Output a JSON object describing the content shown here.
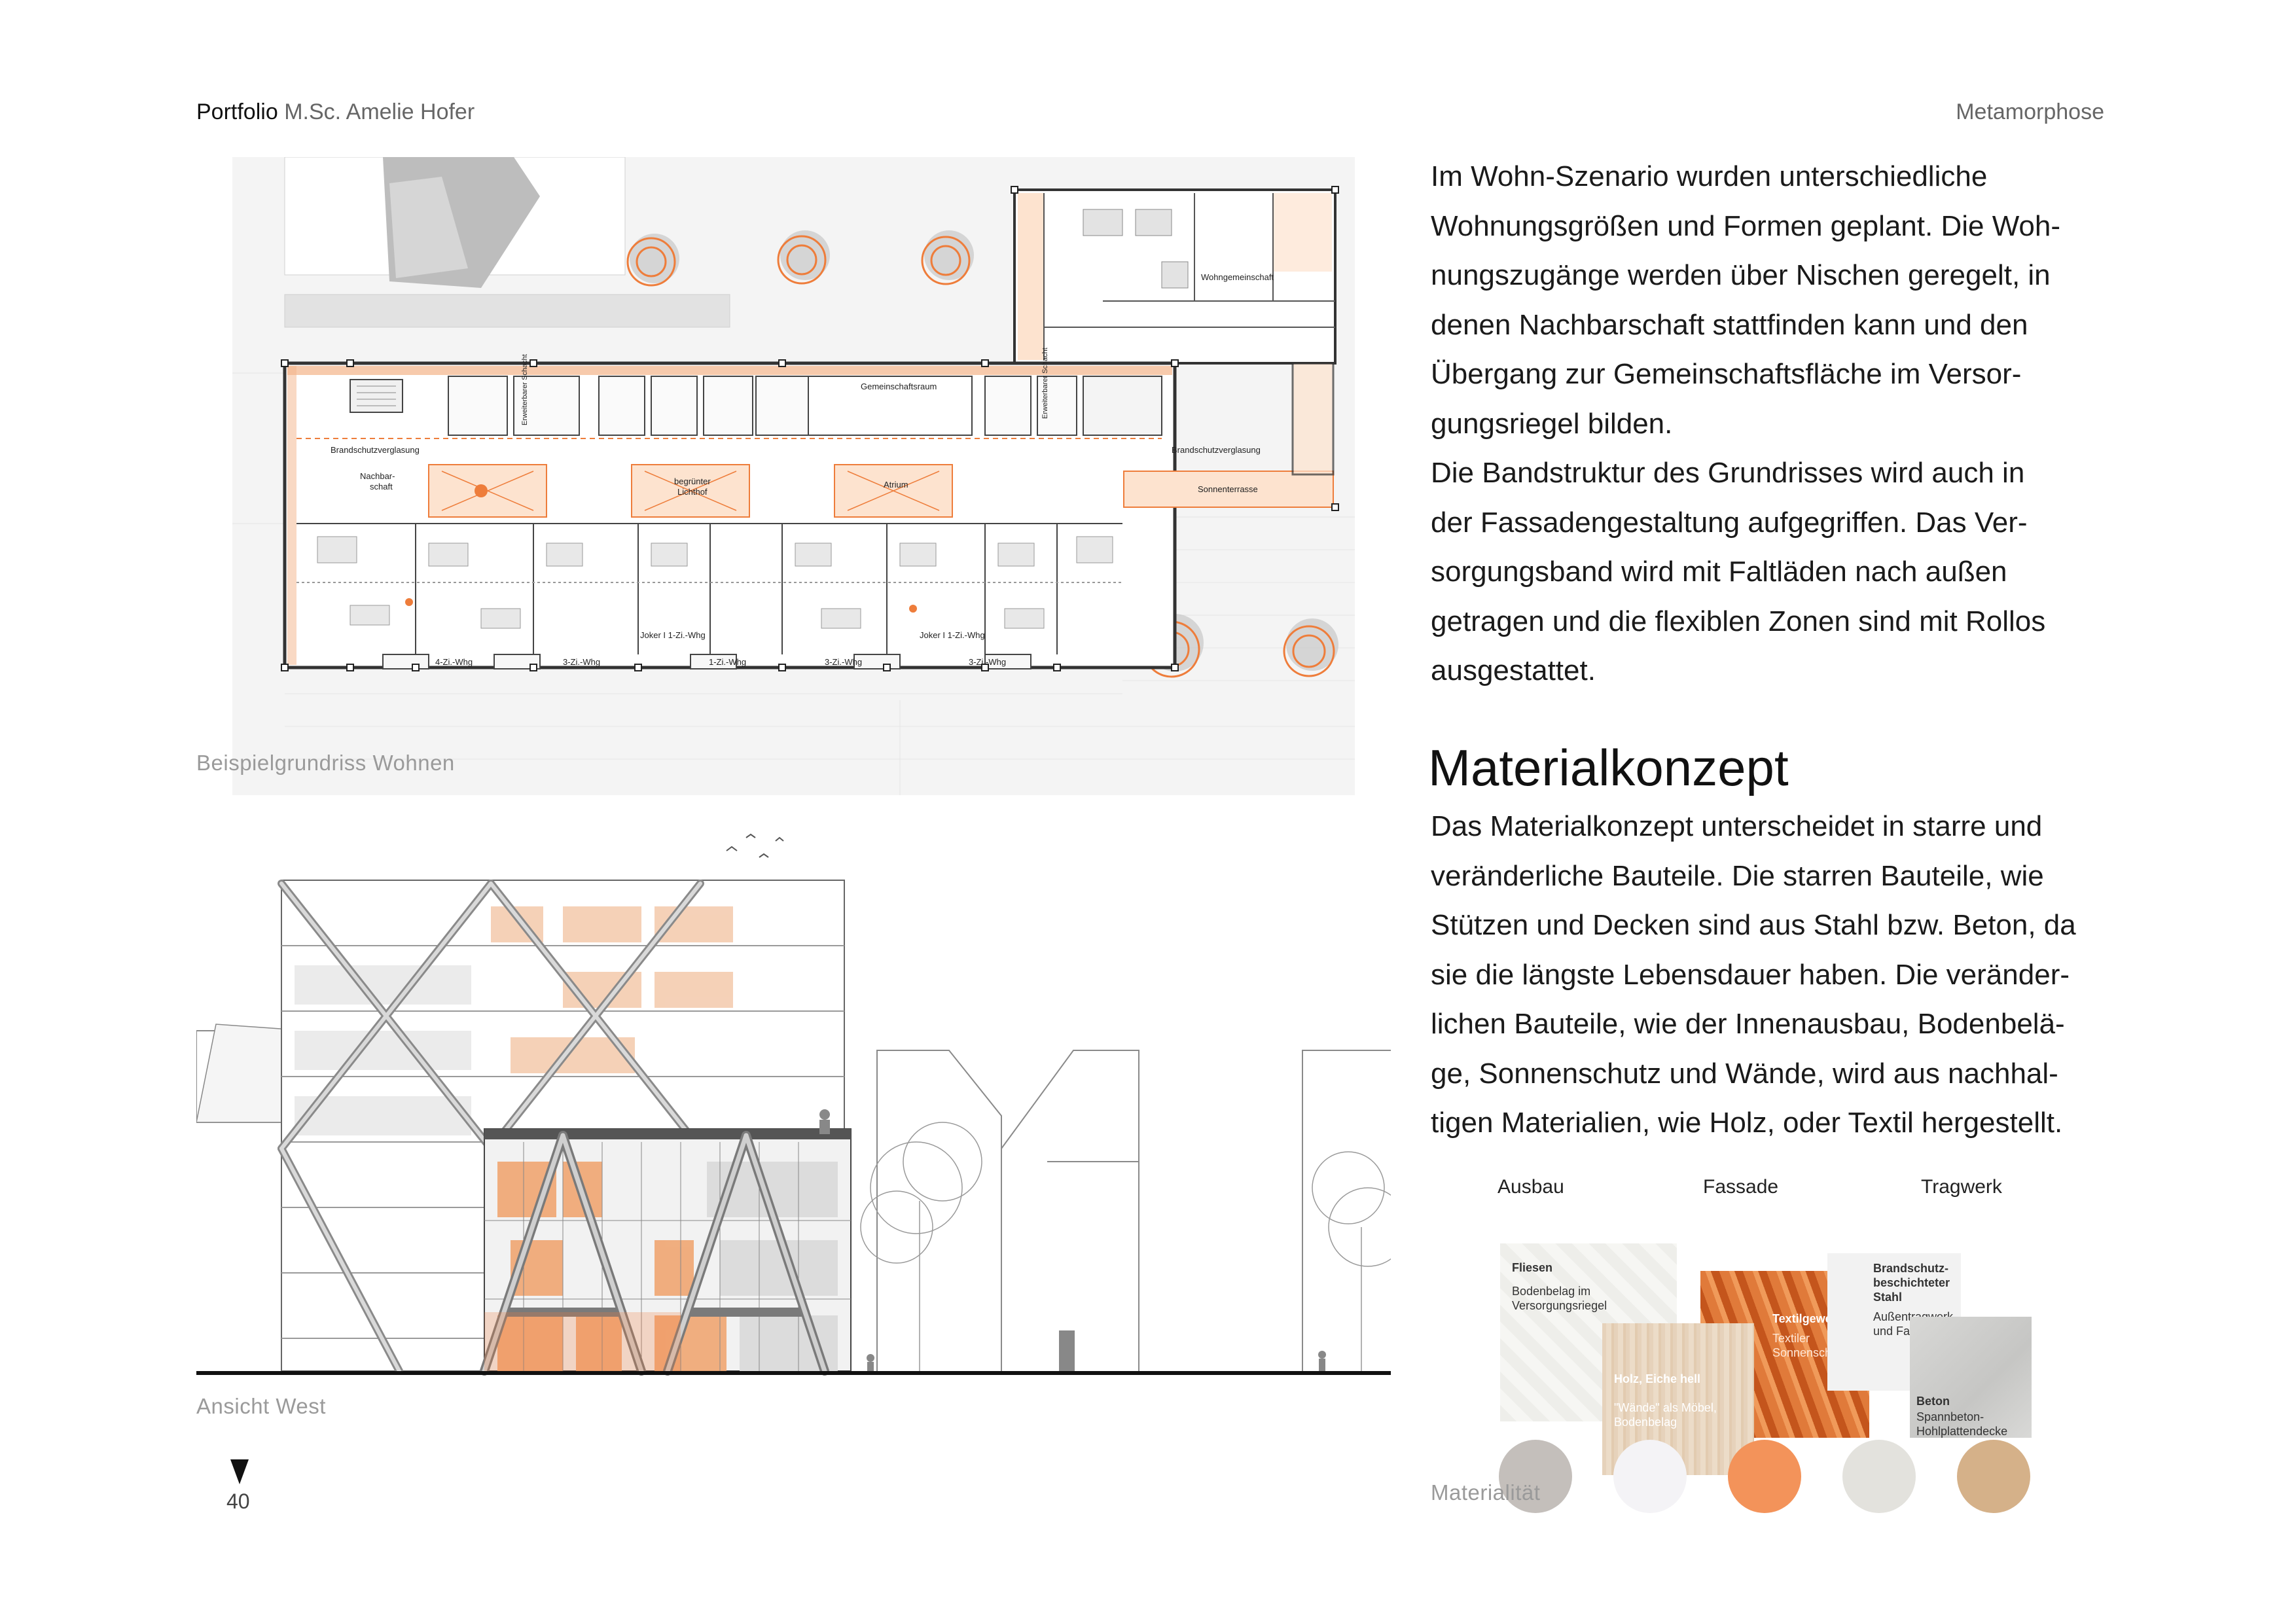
{
  "header": {
    "portfolio_word": "Portfolio",
    "author": "M.Sc. Amelie Hofer",
    "project": "Metamorphose"
  },
  "floorplan": {
    "caption": "Beispielgrundriss Wohnen",
    "labels": {
      "wohngemeinschaft": "Wohngemeinschaft",
      "gemeinschaftsraum": "Gemeinschaftsraum",
      "brandschutz_left": "Brandschutzverglasung",
      "brandschutz_right": "Brandschutzverglasung",
      "sonnenterrasse": "Sonnenterrasse",
      "nachbarschaft": "Nachbar-\nschaft",
      "lichthof": "begrünter\nLichthof",
      "atrium": "Atrium",
      "erweiterbar_1": "Erweiterbarer Schacht",
      "erweiterbar_2": "Erweiterbarer Schacht",
      "unit_4zi": "4-Zi.-Whg",
      "unit_3zi_a": "3-Zi.-Whg",
      "unit_joker_a": "Joker I 1-Zi.-Whg",
      "unit_1zi": "1-Zi.-Whg",
      "unit_3zi_b": "3-Zi.-Whg",
      "unit_joker_b": "Joker I 1-Zi.-Whg",
      "unit_3zi_c": "3-Zi.-Whg"
    }
  },
  "elevation": {
    "caption": "Ansicht West"
  },
  "page_number": "40",
  "text": {
    "paragraph_lines": [
      "Im Wohn-Szenario wurden unterschiedliche",
      "Wohnungsgrößen und Formen geplant. Die Woh-",
      "nungszugänge werden über Nischen geregelt, in",
      "denen Nachbarschaft stattfinden kann und den",
      "Übergang zur Gemeinschaftsfläche im Versor-",
      "gungsriegel bilden.",
      "Die Bandstruktur des Grundrisses wird auch in",
      "der Fassadengestaltung aufgegriffen. Das Ver-",
      "sorgungsband wird mit Faltläden nach außen",
      "getragen und die flexiblen Zonen sind mit Rollos",
      "ausgestattet."
    ],
    "heading": "Materialkonzept",
    "material_lines": [
      "Das Materialkonzept unterscheidet in starre und",
      "veränderliche Bauteile. Die starren Bauteile, wie",
      "Stützen und Decken sind aus Stahl bzw. Beton, da",
      "sie die längste Lebensdauer haben. Die veränder-",
      "lichen Bauteile,  wie der Innenausbau, Bodenbelä-",
      "ge, Sonnenschutz und Wände, wird aus nachhal-",
      "tigen Materialien, wie Holz, oder Textil hergestellt."
    ]
  },
  "materials": {
    "columns": [
      "Ausbau",
      "Fassade",
      "Tragwerk"
    ],
    "caption": "Materialität",
    "swatches": {
      "fliesen_title": "Fliesen",
      "fliesen_desc": "Bodenbelag im\nVersorgungsriegel",
      "holz_title": "Holz, Eiche hell",
      "holz_desc": "\"Wände\" als Möbel,\nBodenbelag",
      "textil_title": "Textilgewebe",
      "textil_desc": "Textiler\nSonnenschutz",
      "stahl_title": "Brandschutz-\nbeschichteter\nStahl",
      "stahl_desc": "Außentragwerk\nund Fassade",
      "beton_title": "Beton",
      "beton_desc": "Spannbeton-\nHohlplattendecke"
    },
    "palette": [
      "#c4bfbb",
      "#f4f3f6",
      "#f3935a",
      "#e3e2dd",
      "#d5b189"
    ]
  },
  "colors": {
    "accent": "#ee7d3b",
    "wall": "#333333"
  }
}
